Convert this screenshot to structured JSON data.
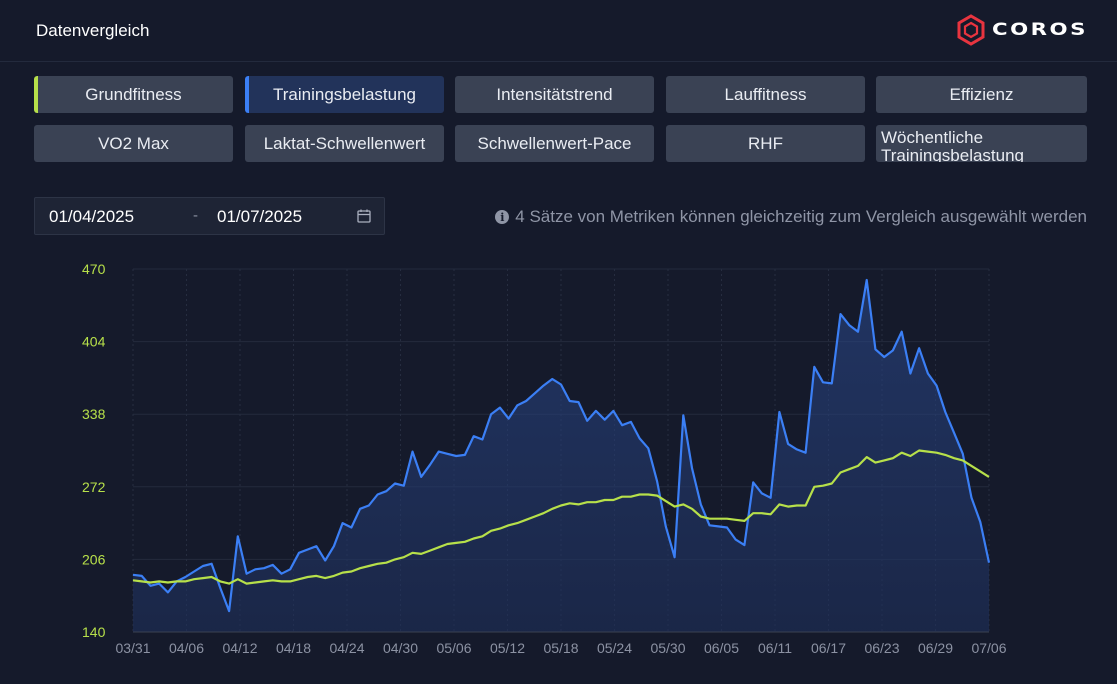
{
  "header": {
    "title": "Datenvergleich",
    "logo_text": "COROS"
  },
  "tabs": [
    {
      "label": "Grundfitness",
      "active": false,
      "indicator": "#b7e04a"
    },
    {
      "label": "Trainingsbelastung",
      "active": true,
      "indicator": "#3b7ff5"
    },
    {
      "label": "Intensitätstrend",
      "active": false
    },
    {
      "label": "Lauffitness",
      "active": false
    },
    {
      "label": "Effizienz",
      "active": false
    },
    {
      "label": "VO2 Max",
      "active": false
    },
    {
      "label": "Laktat-Schwellenwert",
      "active": false
    },
    {
      "label": "Schwellenwert-Pace",
      "active": false
    },
    {
      "label": "RHF",
      "active": false
    },
    {
      "label": "Wöchentliche Trainingsbelastung",
      "active": false
    }
  ],
  "date_range": {
    "start": "01/04/2025",
    "separator": "-",
    "end": "01/07/2025"
  },
  "info_text": "4 Sätze von Metriken können gleichzeitig zum Vergleich ausgewählt werden",
  "chart_data": {
    "type": "line",
    "y_ticks": [
      140,
      206,
      272,
      338,
      404,
      470
    ],
    "ylim": [
      140,
      470
    ],
    "x_ticks": [
      "03/31",
      "04/06",
      "04/12",
      "04/18",
      "04/24",
      "04/30",
      "05/06",
      "05/12",
      "05/18",
      "05/24",
      "05/30",
      "06/05",
      "06/11",
      "06/17",
      "06/23",
      "06/29",
      "07/06"
    ],
    "colors": {
      "training_load": "#3b7ff5",
      "base_fitness": "#b7e04a"
    },
    "series": [
      {
        "key": "training_load",
        "values": [
          192,
          191,
          182,
          184,
          176,
          186,
          190,
          195,
          200,
          202,
          180,
          159,
          227,
          193,
          197,
          198,
          201,
          193,
          197,
          212,
          215,
          218,
          205,
          218,
          239,
          235,
          252,
          255,
          265,
          268,
          275,
          273,
          304,
          281,
          292,
          304,
          302,
          300,
          301,
          318,
          315,
          338,
          344,
          334,
          346,
          350,
          357,
          364,
          370,
          365,
          350,
          349,
          332,
          341,
          333,
          341,
          328,
          331,
          316,
          307,
          277,
          236,
          208,
          337,
          289,
          256,
          237,
          236,
          235,
          224,
          219,
          276,
          266,
          262,
          340,
          311,
          306,
          303,
          381,
          367,
          366,
          429,
          419,
          413,
          460,
          397,
          390,
          396,
          413,
          375,
          398,
          375,
          364,
          340,
          321,
          302,
          262,
          240,
          203
        ],
        "fill": true
      },
      {
        "key": "base_fitness",
        "values": [
          187,
          186,
          185,
          186,
          185,
          186,
          186,
          188,
          189,
          190,
          186,
          184,
          188,
          184,
          185,
          186,
          187,
          186,
          186,
          188,
          190,
          191,
          189,
          191,
          194,
          195,
          198,
          200,
          202,
          203,
          206,
          208,
          212,
          211,
          214,
          217,
          220,
          221,
          222,
          225,
          227,
          232,
          234,
          237,
          239,
          242,
          245,
          248,
          252,
          255,
          257,
          256,
          258,
          258,
          260,
          260,
          263,
          263,
          265,
          265,
          264,
          259,
          254,
          256,
          252,
          245,
          243,
          243,
          243,
          242,
          241,
          248,
          248,
          247,
          256,
          254,
          255,
          255,
          272,
          273,
          275,
          285,
          288,
          291,
          299,
          294,
          296,
          298,
          303,
          300,
          305,
          304,
          303,
          301,
          298,
          296,
          291,
          286,
          281
        ]
      }
    ]
  }
}
